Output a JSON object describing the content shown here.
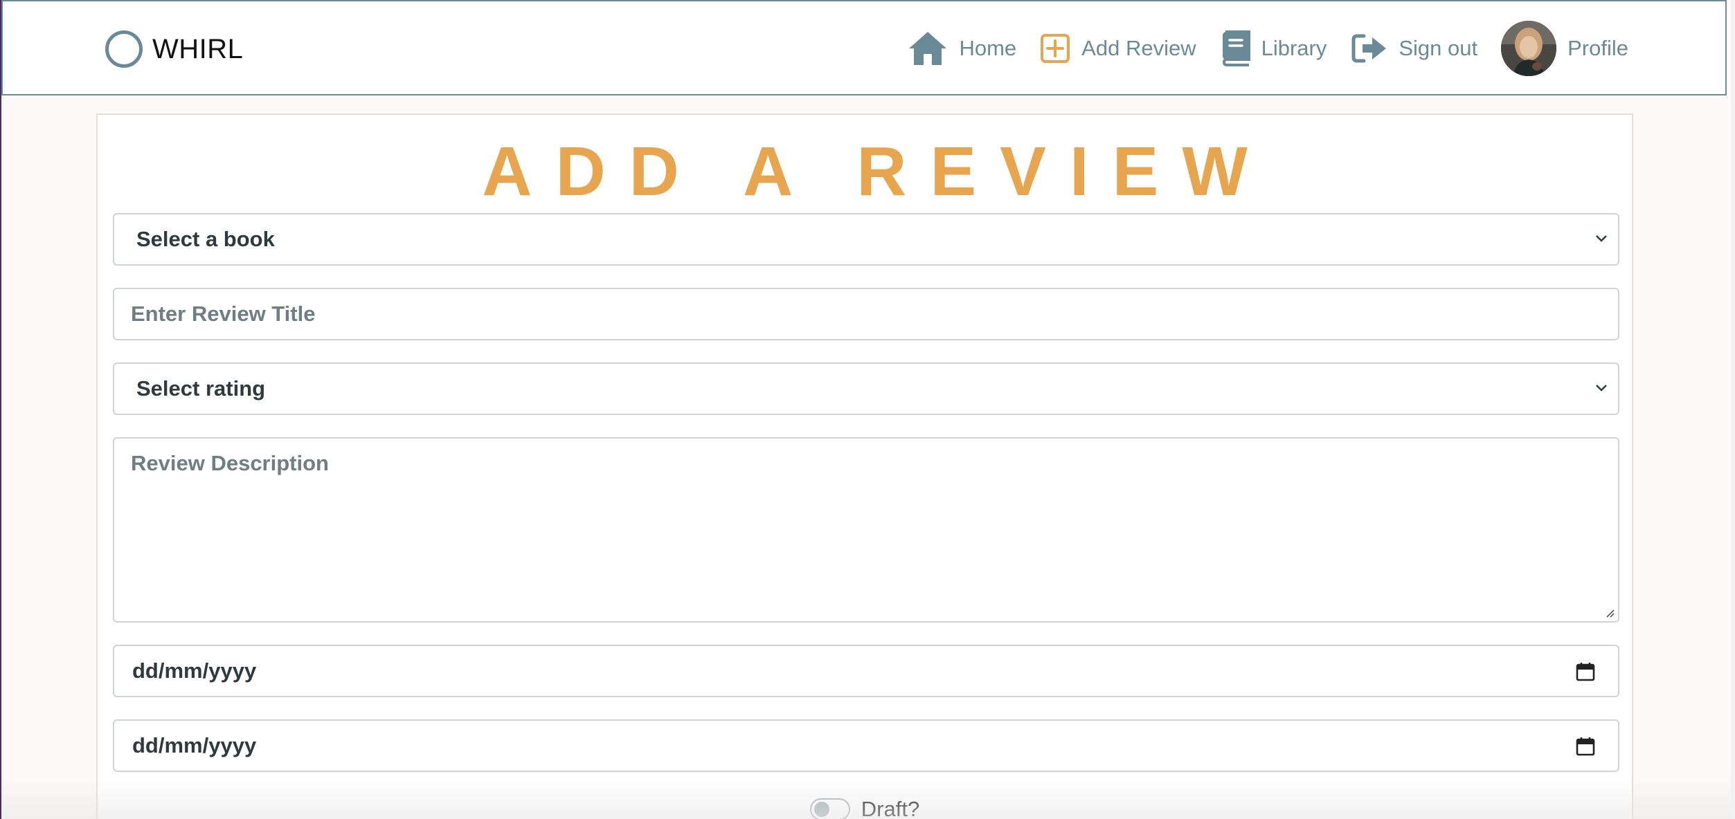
{
  "brand": {
    "name": "WHIRL"
  },
  "nav": {
    "home": "Home",
    "add_review": "Add Review",
    "library": "Library",
    "sign_out": "Sign out",
    "profile": "Profile"
  },
  "form": {
    "heading": "ADD A REVIEW",
    "book_select": "Select a book",
    "title_placeholder": "Enter Review Title",
    "rating_select": "Select rating",
    "description_placeholder": "Review Description",
    "start_date_placeholder": "dd/mm/yyyy",
    "end_date_placeholder": "dd/mm/yyyy",
    "draft_label": "Draft?"
  },
  "colors": {
    "accent": "#e6a54e",
    "nav_text": "#6b8a98",
    "page_bg": "#fdf9f8"
  }
}
